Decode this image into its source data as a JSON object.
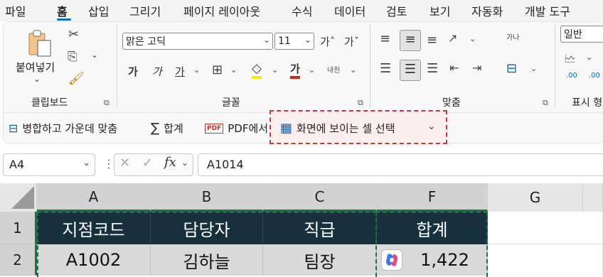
{
  "menu": {
    "tabs": [
      "파일",
      "홈",
      "삽입",
      "그리기",
      "페이지 레이아웃",
      "수식",
      "데이터",
      "검토",
      "보기",
      "자동화",
      "개발 도구"
    ],
    "active": "홈"
  },
  "ribbon": {
    "clipboard": {
      "paste_label": "붙여넣기",
      "group_label": "클립보드"
    },
    "font": {
      "font_name": "맑은 고딕",
      "font_size": "11",
      "grow_label": "가ˆ",
      "shrink_label": "가ˇ",
      "bold_label": "가",
      "italic_label": "가",
      "underline_label": "가",
      "fontcolor_label": "가",
      "phonetic_label": "내천",
      "group_label": "글꼴"
    },
    "alignment": {
      "wrap_label": "가나",
      "group_label": "맞춤"
    },
    "number": {
      "format_value": "일반",
      "dec_inc": ".00",
      "dec_dec": ".00",
      "group_label": "표시 형"
    }
  },
  "quickbar": {
    "merge_label": "병합하고 가운데 맞춤",
    "sum_label": "합계",
    "pdf_label": "PDF에서",
    "visible_cells_label": "화면에 보이는 셀 선택",
    "highlight_color": "#d13438"
  },
  "formula_bar": {
    "name_box": "A4",
    "formula": "A1014"
  },
  "grid": {
    "columns": [
      "A",
      "B",
      "C",
      "F",
      "G"
    ],
    "rows": [
      "1",
      "2"
    ],
    "header_row": [
      "지점코드",
      "담당자",
      "직급",
      "합계"
    ],
    "data_row": [
      "A1002",
      "김하늘",
      "팀장",
      "1,422"
    ],
    "header_fill": "#17303d",
    "selection_color": "#1e7145"
  }
}
